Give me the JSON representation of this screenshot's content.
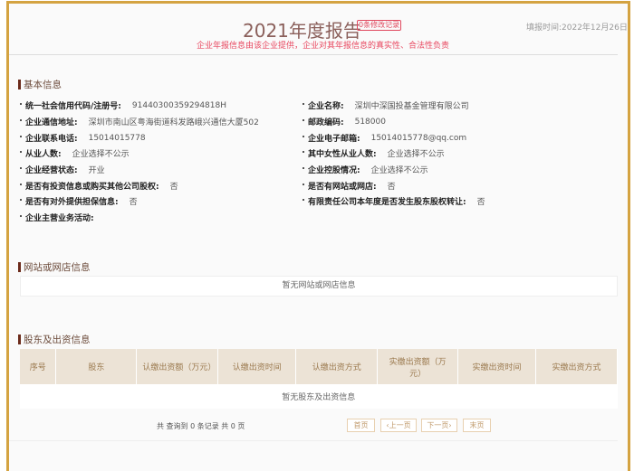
{
  "header": {
    "title": "2021年度报告",
    "badge": "0条修改记录",
    "subtitle": "企业年报信息由该企业提供，企业对其年报信息的真实性、合法性负责",
    "date": "填报时间:2022年12月26日"
  },
  "basic": {
    "title": "基本信息",
    "left": [
      {
        "label": "统一社会信用代码/注册号:",
        "value": "91440300359294818H"
      },
      {
        "label": "企业通信地址:",
        "value": "深圳市南山区粤海街道科发路峨兴通信大厦502"
      },
      {
        "label": "企业联系电话:",
        "value": "15014015778"
      },
      {
        "label": "从业人数:",
        "value": "企业选择不公示"
      },
      {
        "label": "企业经营状态:",
        "value": "开业"
      },
      {
        "label": "是否有投资信息或购买其他公司股权:",
        "value": "否"
      },
      {
        "label": "是否有对外提供担保信息:",
        "value": "否"
      },
      {
        "label": "企业主营业务活动:",
        "value": ""
      }
    ],
    "right": [
      {
        "label": "企业名称:",
        "value": "深圳中深国投基金管理有限公司"
      },
      {
        "label": "邮政编码:",
        "value": "518000"
      },
      {
        "label": "企业电子邮箱:",
        "value": "15014015778@qq.com"
      },
      {
        "label": "其中女性从业人数:",
        "value": "企业选择不公示"
      },
      {
        "label": "企业控股情况:",
        "value": "企业选择不公示"
      },
      {
        "label": "是否有网站或网店:",
        "value": "否"
      },
      {
        "label": "有限责任公司本年度是否发生股东股权转让:",
        "value": "否"
      }
    ]
  },
  "website": {
    "title": "网站或网店信息",
    "empty": "暂无网站或网店信息"
  },
  "shareholders": {
    "title": "股东及出资信息",
    "columns": [
      "序号",
      "股东",
      "认缴出资额（万元）",
      "认缴出资时间",
      "认缴出资方式",
      "实缴出资额（万元）",
      "实缴出资时间",
      "实缴出资方式"
    ],
    "empty": "暂无股东及出资信息",
    "pagination": {
      "info": "共 查询到 0 条记录 共 0 页",
      "first": "首页",
      "prev": "‹上一页",
      "next": "下一页›",
      "last": "末页"
    }
  }
}
